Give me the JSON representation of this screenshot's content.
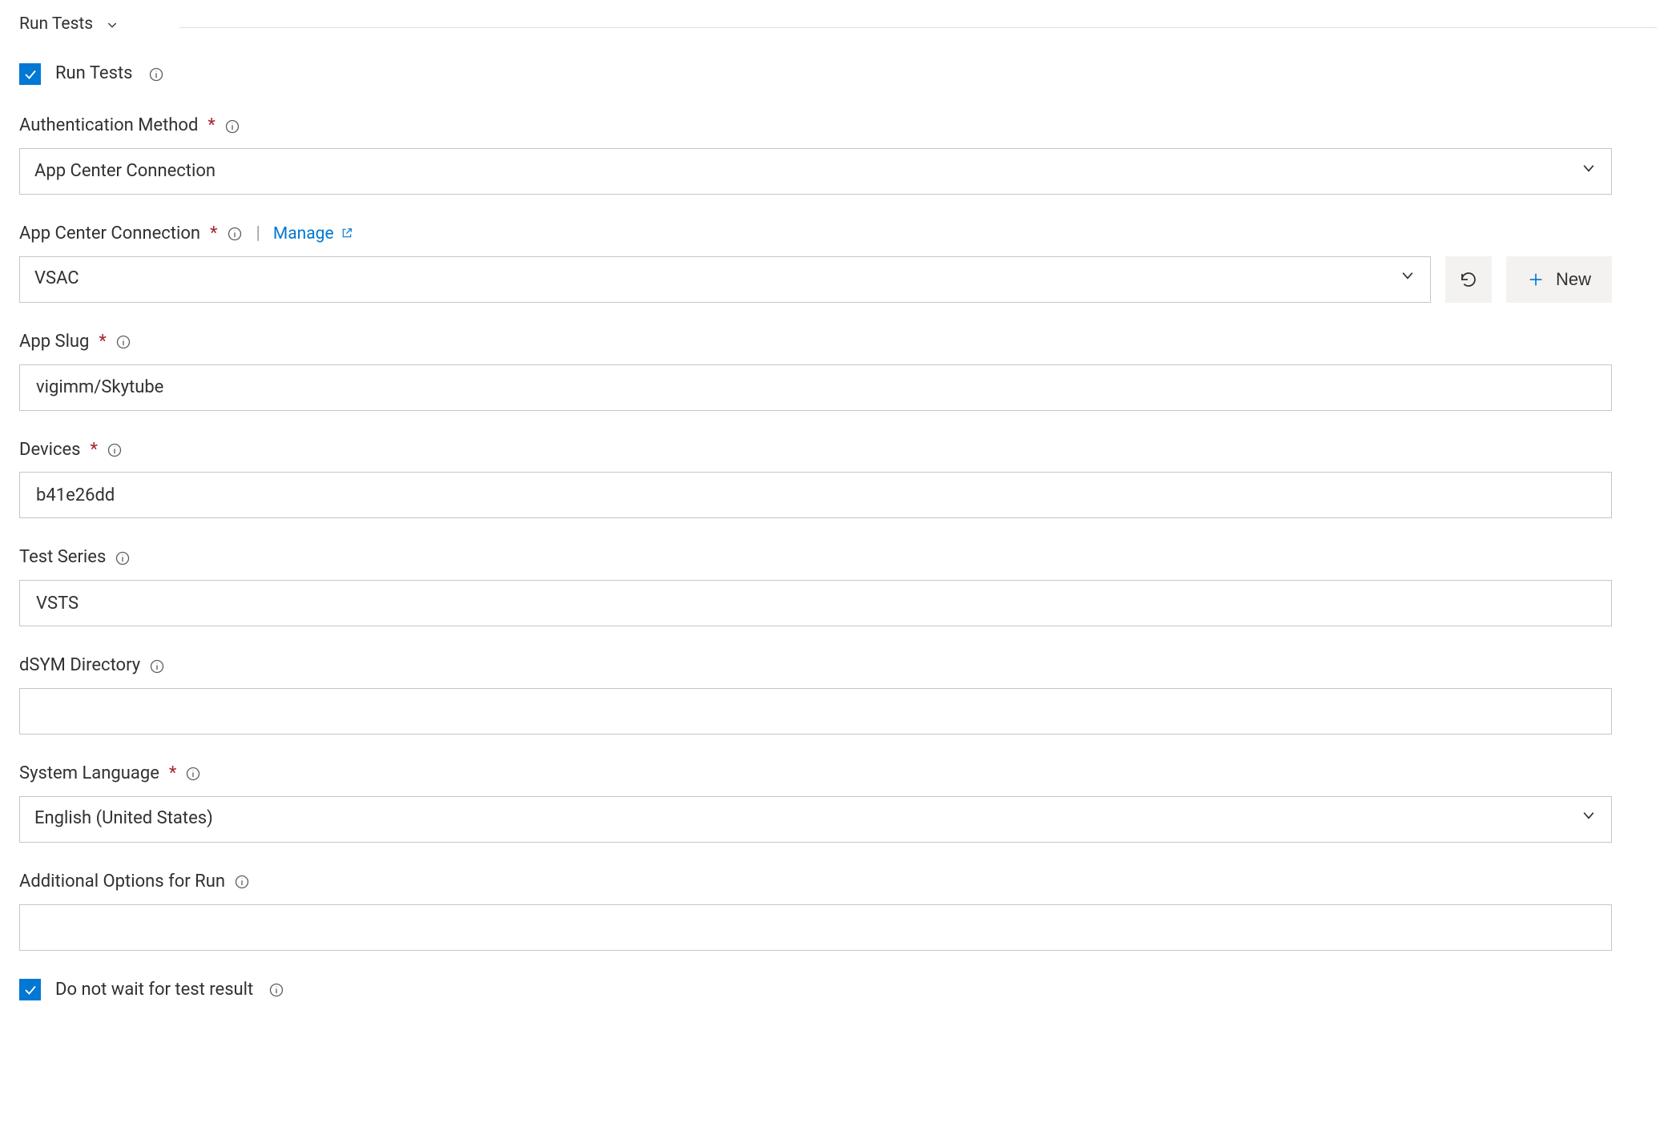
{
  "section": {
    "title": "Run Tests"
  },
  "runTests": {
    "label": "Run Tests",
    "checked": true
  },
  "fields": {
    "authMethod": {
      "label": "Authentication Method",
      "required": true,
      "value": "App Center Connection"
    },
    "appCenterConnection": {
      "label": "App Center Connection",
      "required": true,
      "manageLabel": "Manage",
      "value": "VSAC",
      "newLabel": "New"
    },
    "appSlug": {
      "label": "App Slug",
      "required": true,
      "value": "vigimm/Skytube"
    },
    "devices": {
      "label": "Devices",
      "required": true,
      "value": "b41e26dd"
    },
    "testSeries": {
      "label": "Test Series",
      "required": false,
      "value": "VSTS"
    },
    "dsymDirectory": {
      "label": "dSYM Directory",
      "required": false,
      "value": ""
    },
    "systemLanguage": {
      "label": "System Language",
      "required": true,
      "value": "English (United States)"
    },
    "additionalOptions": {
      "label": "Additional Options for Run",
      "required": false,
      "value": ""
    },
    "doNotWait": {
      "label": "Do not wait for test result",
      "checked": true
    }
  }
}
